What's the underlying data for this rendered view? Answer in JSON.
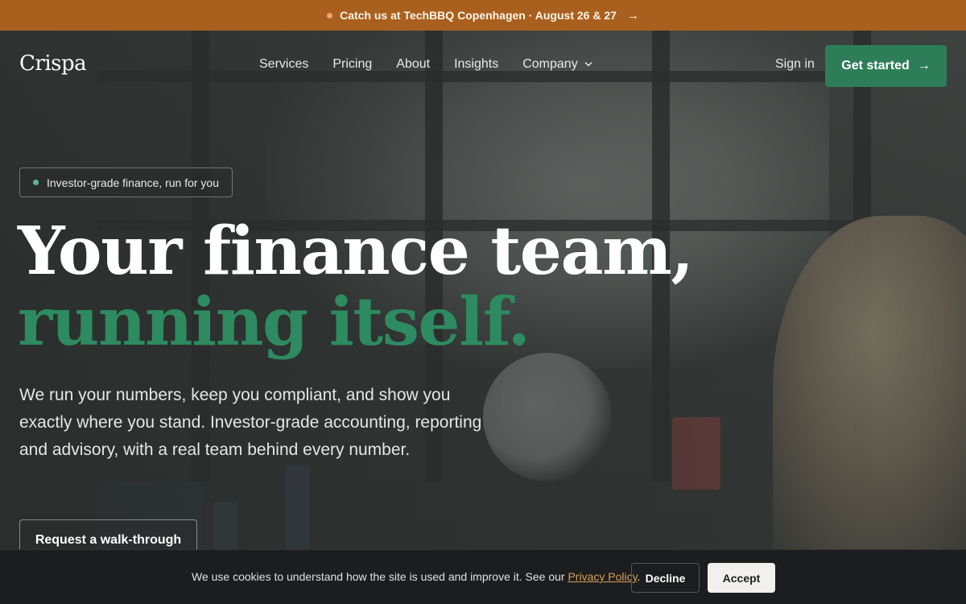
{
  "announcement": {
    "text": "Catch us at TechBBQ Copenhagen · August 26 & 27",
    "arrow_icon": "arrow-right-icon",
    "dot_color": "#f4a06b",
    "background": "#a9601f"
  },
  "header": {
    "logo": "Crispa",
    "nav": [
      {
        "label": "Services"
      },
      {
        "label": "Pricing"
      },
      {
        "label": "About"
      },
      {
        "label": "Insights"
      },
      {
        "label": "Company",
        "has_dropdown": true,
        "icon": "chevron-down-icon"
      }
    ],
    "sign_in": "Sign in",
    "cta_label": "Get started",
    "cta_icon": "arrow-right-icon",
    "cta_color": "#2e7d59"
  },
  "hero": {
    "badge": "Investor-grade finance, run for you",
    "headline_line1": "Your finance team,",
    "headline_line2": "running itself.",
    "accent_color": "#2e8a60",
    "description": "We run your numbers, keep you compliant, and show you exactly where you stand. Investor-grade accounting, reporting and advisory, with a real team behind every number.",
    "secondary_cta": "Request a walk-through"
  },
  "cookie": {
    "message": "We use cookies to understand how the site is used and improve it. See our",
    "link_label": "Privacy Policy",
    "period": ".",
    "decline_label": "Decline",
    "accept_label": "Accept"
  }
}
